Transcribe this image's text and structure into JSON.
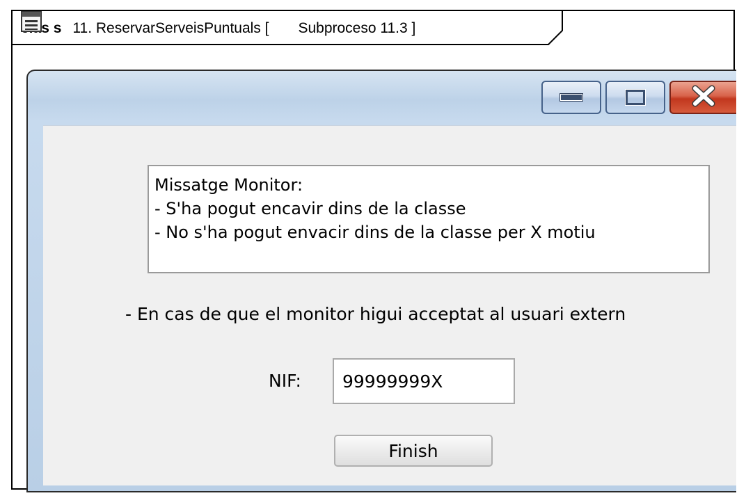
{
  "diagram_frame": {
    "keyword": "clas s",
    "name": "11. ReservarServeisPuntuals [",
    "subprocess_label": "Subproceso 11.3 ]",
    "doc_icon": "document-icon"
  },
  "window": {
    "caption_buttons": {
      "minimize_icon": "minimize-icon",
      "maximize_icon": "maximize-icon",
      "close_icon": "close-icon"
    },
    "message_box": {
      "lines": [
        "Missatge Monitor:",
        "- S'ha pogut encavir dins de la classe",
        "- No s'ha pogut envacir dins de la classe per X motiu"
      ]
    },
    "info_text": "- En cas de que el monitor higui acceptat al usuari extern",
    "nif_label": "NIF:",
    "nif_value": "99999999X",
    "finish_label": "Finish"
  },
  "colors": {
    "title_bar": "#c7daee",
    "close_button": "#c2371e",
    "client_bg": "#f0f0f0"
  }
}
